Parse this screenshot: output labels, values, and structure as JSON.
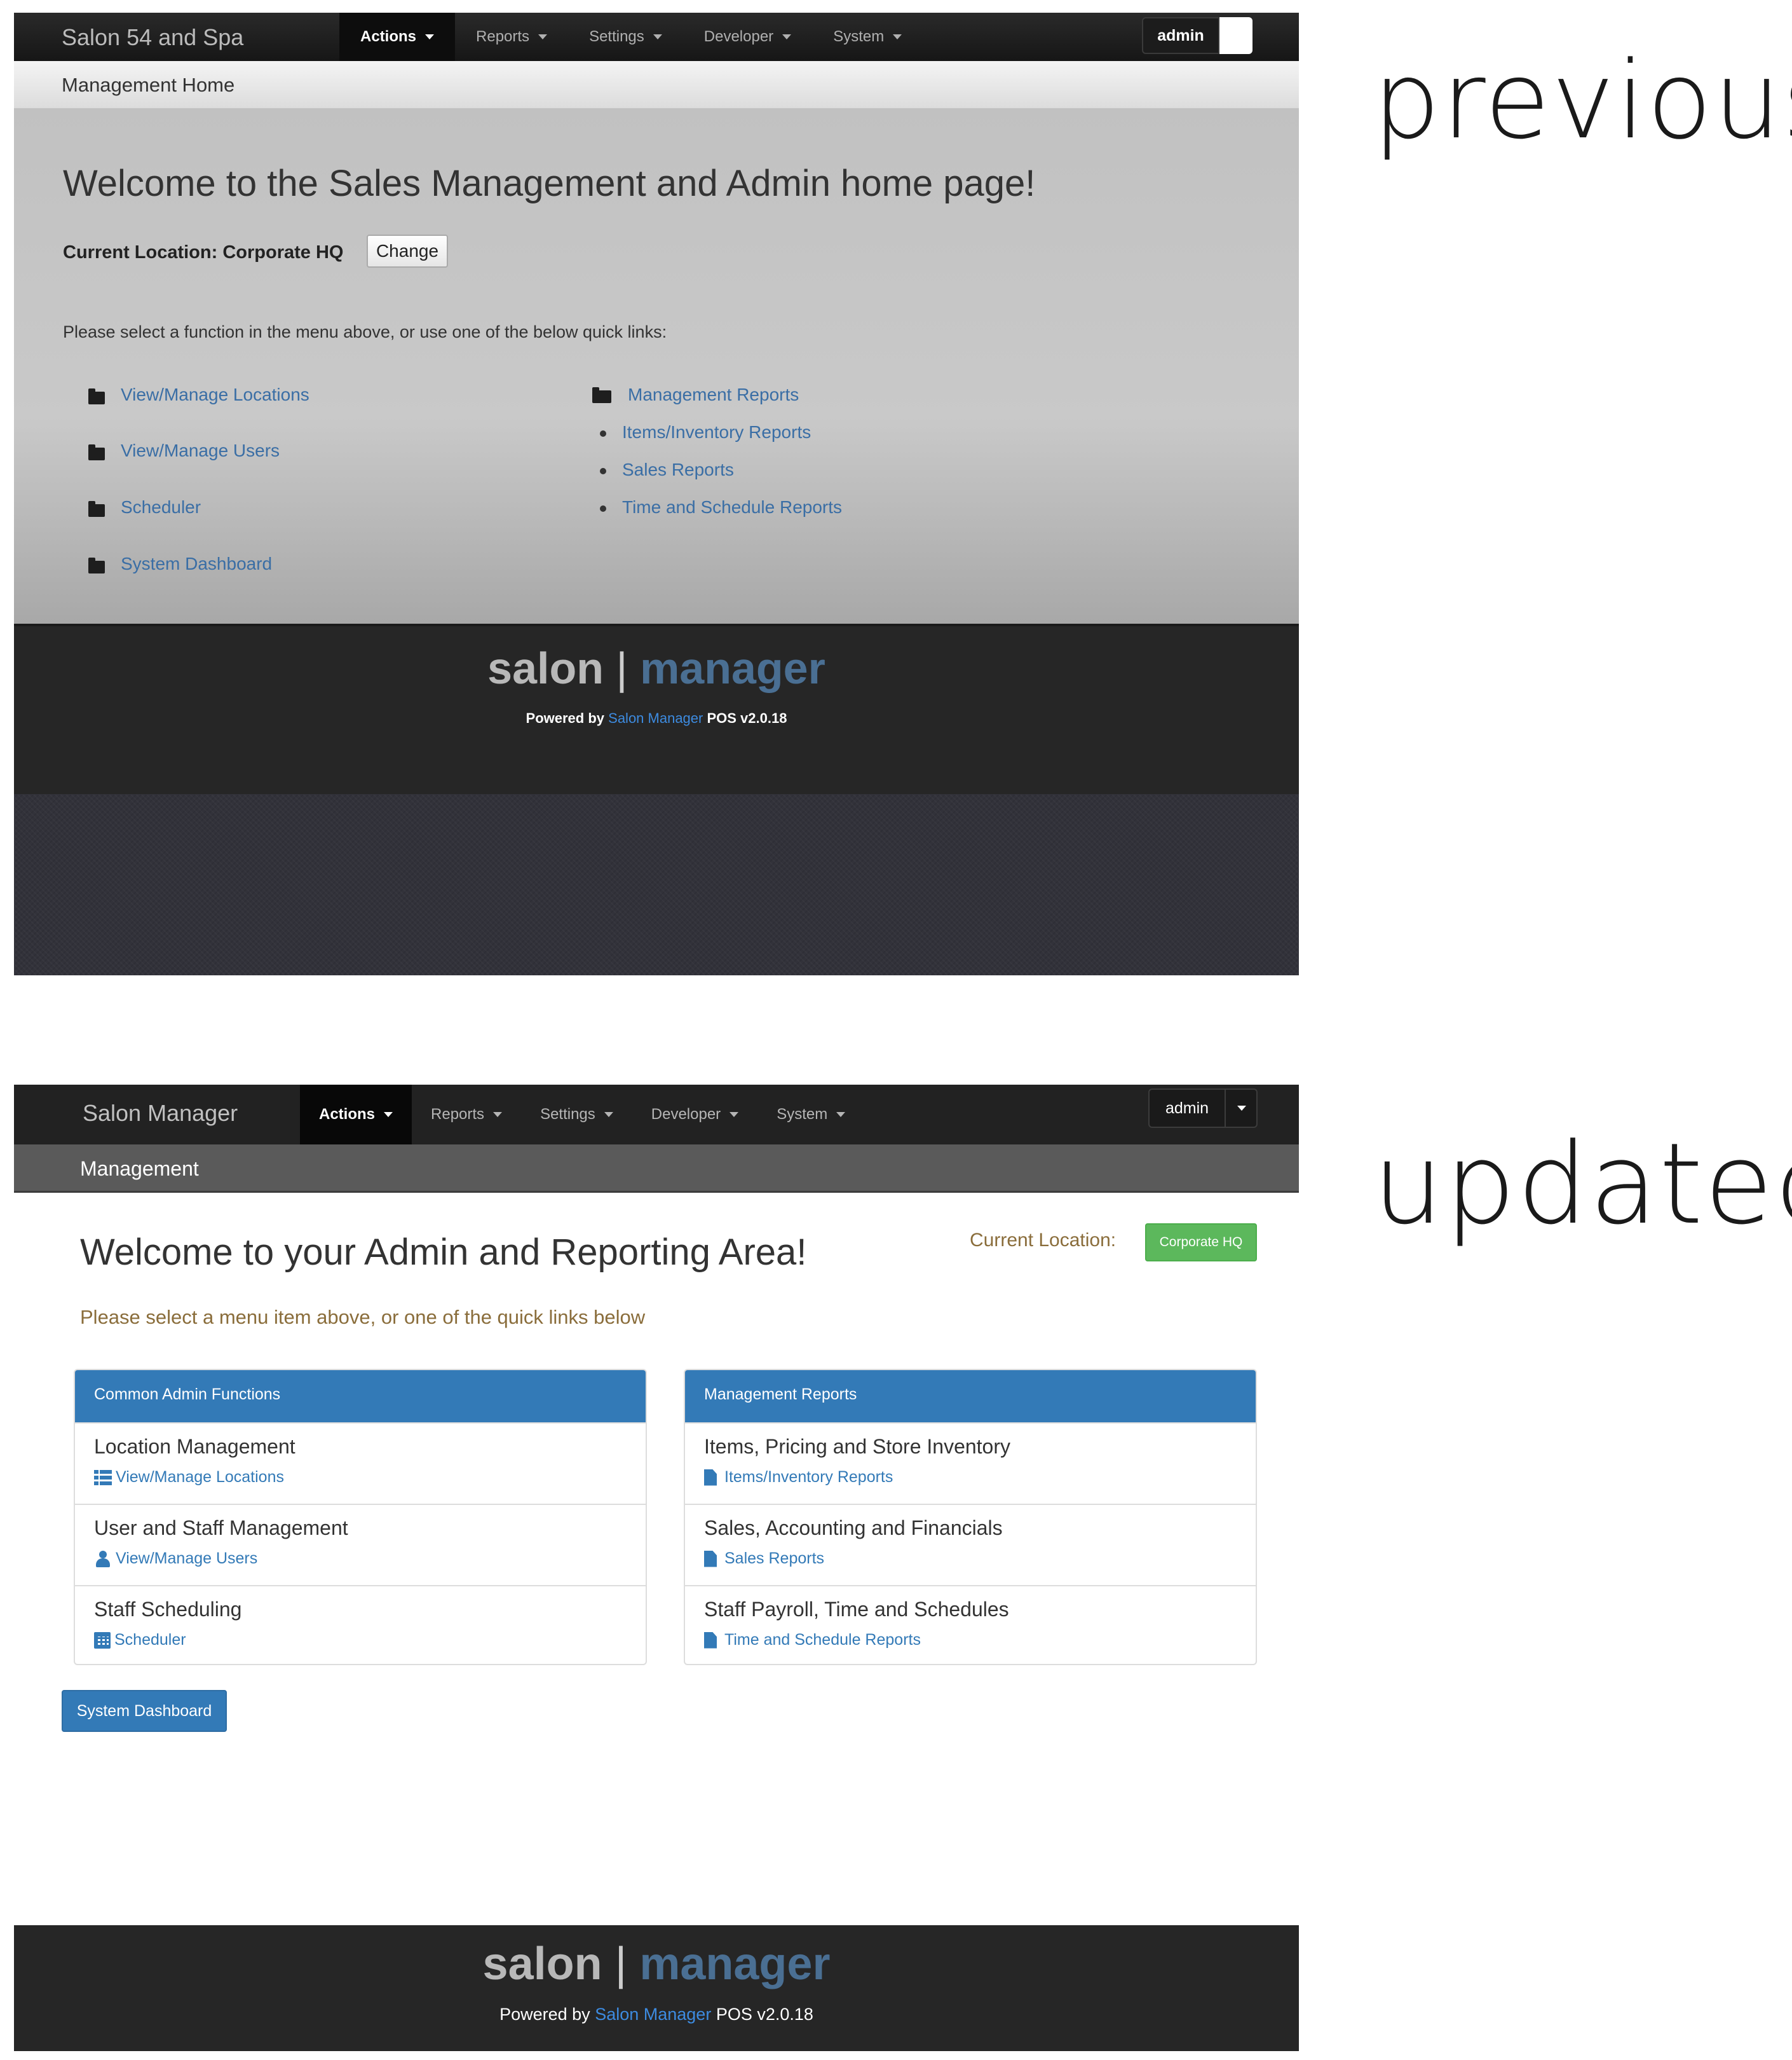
{
  "labels": {
    "previous": "previous",
    "updated": "updated"
  },
  "previous": {
    "brand": "Salon 54 and Spa",
    "menu": [
      {
        "label": "Actions",
        "active": true
      },
      {
        "label": "Reports"
      },
      {
        "label": "Settings"
      },
      {
        "label": "Developer"
      },
      {
        "label": "System"
      }
    ],
    "user": "admin",
    "subheader": "Management Home",
    "heading": "Welcome to the Sales Management and Admin home page!",
    "location_text": "Current Location: Corporate HQ",
    "change_button": "Change",
    "instructions": "Please select a function in the menu above, or use one of the below quick links:",
    "left_links": [
      "View/Manage Locations",
      "View/Manage Users",
      "Scheduler",
      "System Dashboard"
    ],
    "reports_folder": "Management Reports",
    "report_links": [
      "Items/Inventory Reports",
      "Sales Reports",
      "Time and Schedule Reports"
    ],
    "footer": {
      "logo_part1": "salon",
      "logo_sep": "|",
      "logo_part2": "manager",
      "powered_prefix": "Powered by",
      "powered_link": "Salon Manager",
      "powered_suffix": "POS v2.0.18"
    }
  },
  "updated": {
    "brand": "Salon Manager",
    "menu": [
      {
        "label": "Actions",
        "active": true
      },
      {
        "label": "Reports"
      },
      {
        "label": "Settings"
      },
      {
        "label": "Developer"
      },
      {
        "label": "System"
      }
    ],
    "user": "admin",
    "subheader": "Management",
    "heading": "Welcome to your Admin and Reporting Area!",
    "location_label": "Current Location:",
    "location_button": "Corporate HQ",
    "instructions": "Please select a menu item above, or one of the quick links below",
    "panel_left": {
      "title": "Common Admin Functions",
      "items": [
        {
          "title": "Location Management",
          "link": "View/Manage Locations",
          "icon": "list-icon"
        },
        {
          "title": "User and Staff Management",
          "link": "View/Manage Users",
          "icon": "user-icon"
        },
        {
          "title": "Staff Scheduling",
          "link": "Scheduler",
          "icon": "calendar-icon"
        }
      ]
    },
    "panel_right": {
      "title": "Management Reports",
      "items": [
        {
          "title": "Items, Pricing and Store Inventory",
          "link": "Items/Inventory Reports",
          "icon": "file-icon"
        },
        {
          "title": "Sales, Accounting and Financials",
          "link": "Sales Reports",
          "icon": "file-icon"
        },
        {
          "title": "Staff Payroll, Time and Schedules",
          "link": "Time and Schedule Reports",
          "icon": "file-icon"
        }
      ]
    },
    "system_dashboard_button": "System Dashboard",
    "footer": {
      "logo_part1": "salon",
      "logo_sep": "|",
      "logo_part2": "manager",
      "powered_prefix": "Powered by",
      "powered_link": "Salon Manager",
      "powered_suffix": "POS v2.0.18"
    }
  },
  "colors": {
    "primary": "#337ab7",
    "success": "#5cb85c",
    "warning_text": "#8a6d3b",
    "navbar": "#222222",
    "logo_gray": "#b8b8b8",
    "logo_blue": "#4a6f93"
  }
}
